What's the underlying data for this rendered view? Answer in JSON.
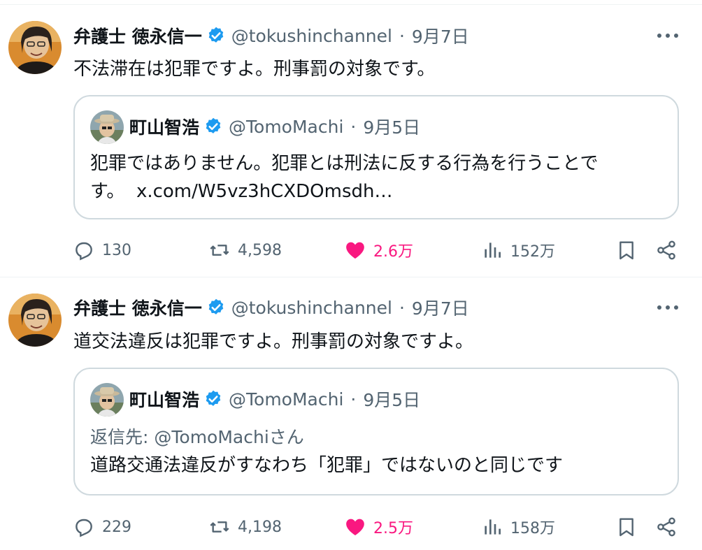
{
  "tweets": [
    {
      "author": {
        "name": "弁護士 徳永信一",
        "handle": "@tokushinchannel",
        "date": "9月7日"
      },
      "text": "不法滞在は犯罪ですよ。刑事罰の対象です。",
      "quote": {
        "author": {
          "name": "町山智浩",
          "handle": "@TomoMachi",
          "date": "9月5日"
        },
        "reply_to": "",
        "text_line1": "犯罪ではありません。犯罪とは刑法に反する行為を行うことで",
        "text_line2": "す。",
        "link": "x.com/W5vz3hCXDOmsdh…"
      },
      "actions": {
        "replies": "130",
        "retweets": "4,598",
        "likes": "2.6万",
        "views": "152万"
      }
    },
    {
      "author": {
        "name": "弁護士 徳永信一",
        "handle": "@tokushinchannel",
        "date": "9月7日"
      },
      "text": "道交法違反は犯罪ですよ。刑事罰の対象ですよ。",
      "quote": {
        "author": {
          "name": "町山智浩",
          "handle": "@TomoMachi",
          "date": "9月5日"
        },
        "reply_to": "返信先: @TomoMachiさん",
        "text_line1": "道路交通法違反がすなわち「犯罪」ではないのと同じです",
        "text_line2": "",
        "link": ""
      },
      "actions": {
        "replies": "229",
        "retweets": "4,198",
        "likes": "2.5万",
        "views": "158万"
      }
    }
  ],
  "icons": {
    "verified": "verified-badge-icon",
    "more": "more-dots-icon",
    "reply": "reply-bubble-icon",
    "retweet": "retweet-icon",
    "like": "heart-icon",
    "views": "views-bar-icon",
    "bookmark": "bookmark-icon",
    "share": "share-icon"
  },
  "colors": {
    "verified": "#1d9bf0",
    "like": "#f91880",
    "secondary": "#536471",
    "border": "#cfd9de"
  }
}
